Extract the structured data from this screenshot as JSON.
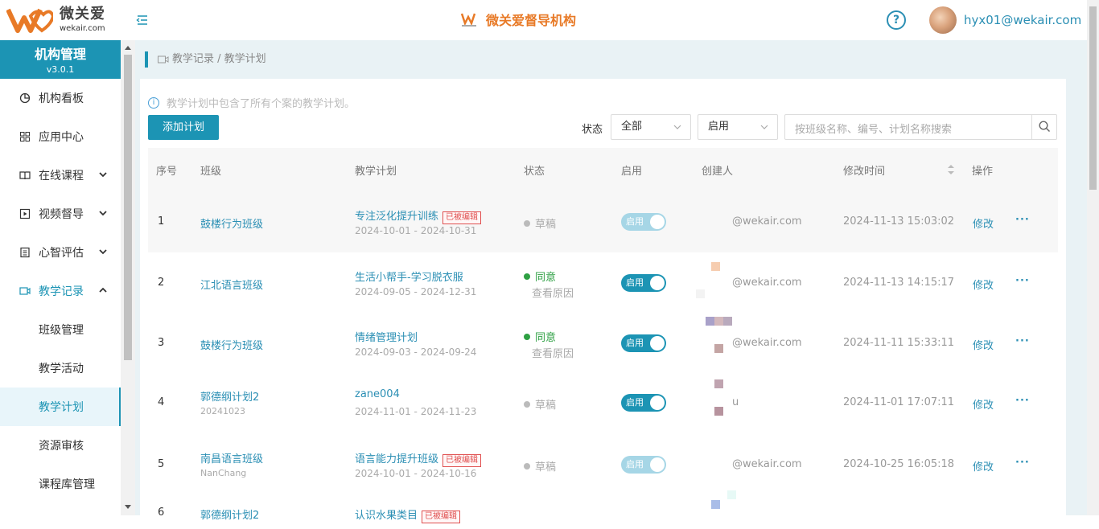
{
  "header": {
    "logo_cn": "微关爱",
    "logo_en": "wekair.com",
    "brand_name": "微关爱督导机构",
    "help_label": "?",
    "user": "hyx01@wekair.com"
  },
  "sidebar": {
    "title": "机构管理",
    "version": "v3.0.1",
    "items": [
      {
        "label": "机构看板",
        "icon": "dashboard-icon"
      },
      {
        "label": "应用中心",
        "icon": "grid-icon"
      },
      {
        "label": "在线课程",
        "icon": "book-icon"
      },
      {
        "label": "视频督导",
        "icon": "play-icon"
      },
      {
        "label": "心智评估",
        "icon": "clipboard-icon"
      },
      {
        "label": "教学记录",
        "icon": "video-icon"
      }
    ],
    "subitems": [
      "班级管理",
      "教学活动",
      "教学计划",
      "资源审核",
      "课程库管理"
    ]
  },
  "breadcrumb": "教学记录 / 教学计划",
  "tip": "教学计划中包含了所有个案的教学计划。",
  "toolbar": {
    "add_label": "添加计划",
    "filter_label": "状态",
    "status_value": "全部",
    "enable_value": "启用",
    "search_placeholder": "按班级名称、编号、计划名称搜索"
  },
  "table": {
    "headers": [
      "序号",
      "班级",
      "教学计划",
      "状态",
      "启用",
      "创建人",
      "修改时间",
      "操作"
    ],
    "edited_tag": "已被编辑",
    "reason_label": "查看原因",
    "edit_label": "修改",
    "more_label": "···",
    "toggle_label": "启用",
    "rows": [
      {
        "no": "1",
        "class": "鼓楼行为班级",
        "class_sub": "",
        "plan": "专注泛化提升训练",
        "edited": true,
        "date": "2024-10-01 - 2024-10-31",
        "status": "草稿",
        "creator": "@wekair.com",
        "mtime": "2024-11-13 15:03:02"
      },
      {
        "no": "2",
        "class": "江北语言班级",
        "class_sub": "",
        "plan": "生活小帮手-学习脱衣服",
        "edited": false,
        "date": "2024-09-05 - 2024-12-31",
        "status": "同意",
        "creator": "@wekair.com",
        "mtime": "2024-11-13 14:15:17"
      },
      {
        "no": "3",
        "class": "鼓楼行为班级",
        "class_sub": "",
        "plan": "情绪管理计划",
        "edited": false,
        "date": "2024-09-03 - 2024-09-24",
        "status": "同意",
        "creator": "@wekair.com",
        "mtime": "2024-11-11 15:33:11"
      },
      {
        "no": "4",
        "class": "郭德纲计划2",
        "class_sub": "20241023",
        "plan": "zane004",
        "edited": false,
        "date": "2024-11-01 - 2024-11-23",
        "status": "草稿",
        "creator": "u",
        "mtime": "2024-11-01 17:07:11"
      },
      {
        "no": "5",
        "class": "南昌语言班级",
        "class_sub": "NanChang",
        "plan": "语言能力提升班级",
        "edited": true,
        "date": "2024-10-01 - 2024-10-16",
        "status": "草稿",
        "creator": "@wekair.com",
        "mtime": "2024-10-25 16:05:18"
      },
      {
        "no": "6",
        "class": "郭德纲计划2",
        "class_sub": "",
        "plan": "认识水果类目",
        "edited": true,
        "date": "",
        "status": "",
        "creator": "",
        "mtime": ""
      }
    ]
  },
  "colors": {
    "accent": "#1c94b4",
    "brand": "#e87a27",
    "approved": "#2ea043",
    "draft": "#bbbbbb",
    "edited": "#e05050"
  }
}
